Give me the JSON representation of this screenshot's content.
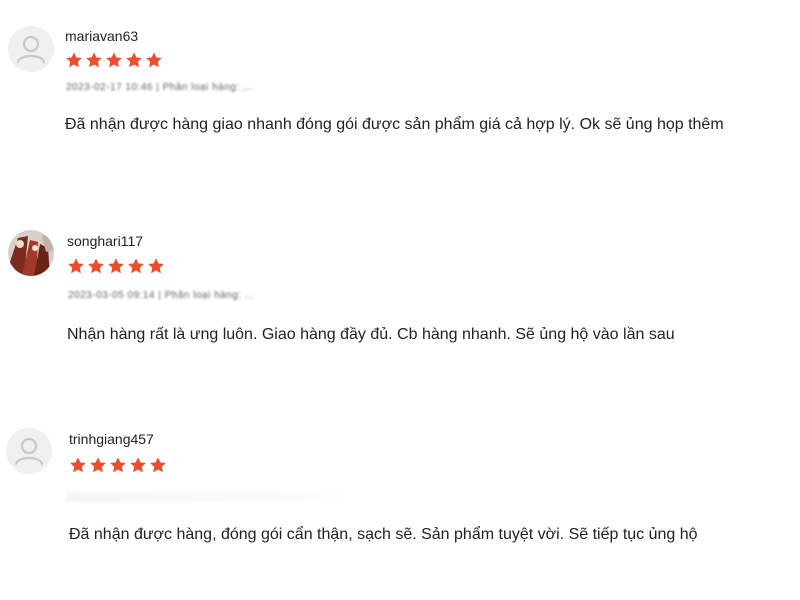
{
  "reviews": [
    {
      "username": "mariavan63",
      "rating": 5,
      "meta": "2023-02-17 10:46 | Phân loại hàng: ...",
      "comment": "Đã nhận được hàng giao nhanh đóng gói được sản phẩm giá cả hợp lý. Ok sẽ ủng họp thêm",
      "avatar": "default-user-icon"
    },
    {
      "username": "songhari117",
      "rating": 5,
      "meta": "2023-03-05 09:14 | Phân loại hàng: ...",
      "comment": "Nhận hàng rất là ưng luôn. Giao hàng đầy đủ. Cb hàng nhanh. Sẽ ủng hộ vào lần sau",
      "avatar": "profile-photo"
    },
    {
      "username": "trinhgiang457",
      "rating": 5,
      "meta": "",
      "comment": "Đã nhận được hàng, đóng gói cẩn thận, sạch sẽ. Sản phẩm tuyệt vời. Sẽ tiếp tục ủng hộ",
      "avatar": "default-user-icon"
    }
  ],
  "colors": {
    "star": "#ee4d2d",
    "avatar_bg": "#eeeeee",
    "avatar_icon": "#c6c6c6"
  }
}
